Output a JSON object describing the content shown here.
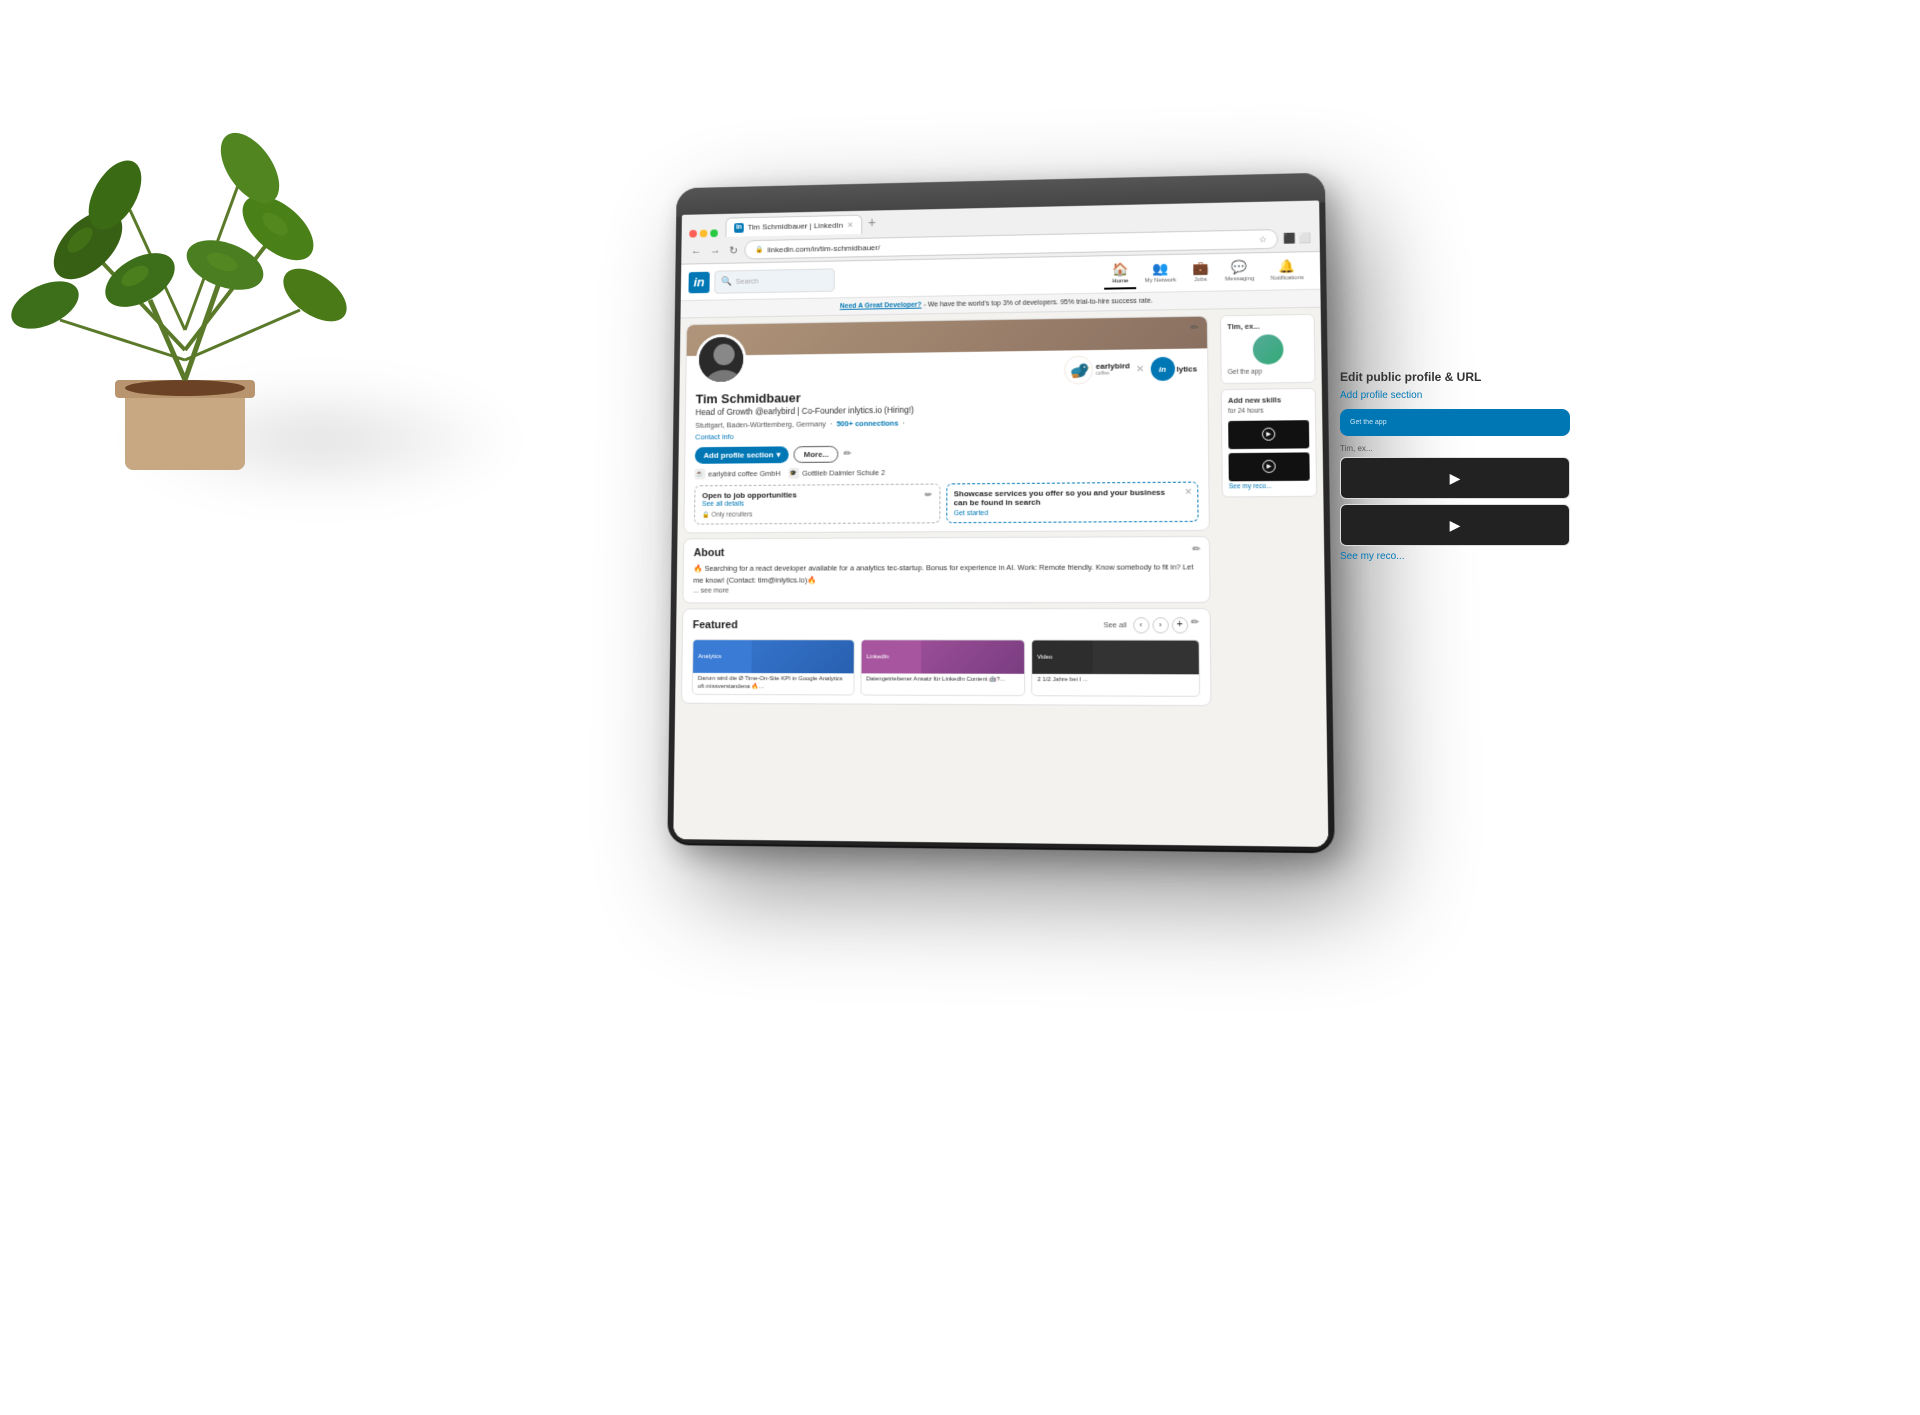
{
  "scene": {
    "background": "#ffffff"
  },
  "browser": {
    "tab_title": "Tim Schmidbauer | LinkedIn",
    "url": "linkedin.com/in/tim-schmidbauer/",
    "new_tab_symbol": "+",
    "nav_back": "←",
    "nav_forward": "→",
    "nav_refresh": "↻"
  },
  "linkedin": {
    "logo": "in",
    "search_placeholder": "Search",
    "nav_items": [
      {
        "icon": "🏠",
        "label": "Home"
      },
      {
        "icon": "👥",
        "label": "My Network"
      },
      {
        "icon": "💼",
        "label": "Jobs"
      },
      {
        "icon": "💬",
        "label": "Messaging"
      },
      {
        "icon": "🔔",
        "label": "Notifications"
      }
    ],
    "ad_text_link": "Need A Great Developer?",
    "ad_text_rest": " - We have the world's top 3% of developers. 95% trial-to-hire success rate.",
    "profile": {
      "name": "Tim Schmidbauer",
      "title": "Head of Growth @earlybird | Co-Founder inlytics.io (Hiring!)",
      "location": "Stuttgart, Baden-Württemberg, Germany",
      "connections": "500+ connections",
      "contact_info": "Contact info",
      "edit_icon": "✏️",
      "company1": "earlybird coffee GmbH",
      "company2": "Gottlieb Daimler Schule 2",
      "earlybird_logo_text": "earlybird",
      "earlybird_sub": "coffee",
      "inlytics_text": "lytics",
      "inlytics_prefix": "in",
      "separator": "✕",
      "actions": {
        "add_profile_section": "Add profile section",
        "more": "More...",
        "dropdown_arrow": "▾"
      }
    },
    "open_to_work": {
      "title": "Open to job opportunities",
      "see_details": "See all details",
      "recruiters_only": "Only recruiters",
      "lock_icon": "🔒"
    },
    "showcase": {
      "title": "Showcase services you offer so you and your business can be found in search",
      "cta": "Get started",
      "close": "✕"
    },
    "about": {
      "section_title": "About",
      "content": "🔥 Searching for a react developer available for a analytics tec-startup. Bonus for experience in AI. Work: Remote friendly. Know somebody to fit in? Let me know! (Contact: tim@inlytics.io)🔥",
      "see_more": "... see more"
    },
    "featured": {
      "section_title": "Featured",
      "see_all": "See all",
      "items": [
        {
          "title": "Darum wird die Ø Time-On-Site KPI in Google Analytics oft missverstandena 🔥...",
          "thumb_color": "#3a7bd5"
        },
        {
          "title": "Datengetriebener Ansatz für LinkedIn Content 🤖?...",
          "thumb_color": "#a855a0"
        },
        {
          "title": "2 1/2 Jahre bei I ...",
          "thumb_color": "#222"
        }
      ]
    },
    "sidebar_right": {
      "edit_public_label": "Edit public profile & URL",
      "add_profile_section_label": "Add profile section",
      "get_the_app_label": "Get the app",
      "user_description": "Tim, ex...",
      "add_skills_label": "Add new skills",
      "add_skills_desc": "for 24 hours",
      "see_my_reco": "See my reco..."
    }
  }
}
